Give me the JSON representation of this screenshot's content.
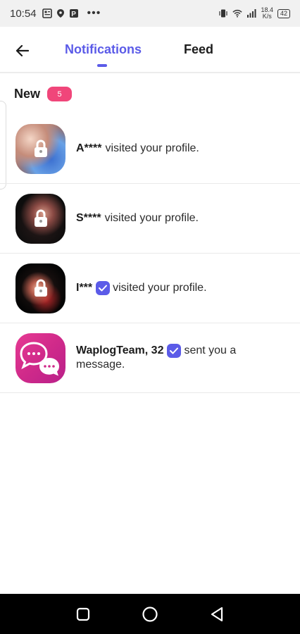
{
  "status_bar": {
    "time": "10:54",
    "dots": "•••",
    "speed_value": "18.4",
    "speed_unit": "K/s",
    "battery": "42"
  },
  "header": {
    "tabs": [
      {
        "label": "Notifications",
        "active": true
      },
      {
        "label": "Feed",
        "active": false
      }
    ],
    "accent_color": "#5b5be8"
  },
  "section": {
    "title": "New",
    "badge_count": "5",
    "badge_color": "#f0467a"
  },
  "notifications": [
    {
      "name": "A****",
      "verified": false,
      "action": "visited your profile.",
      "avatar_icon": "lock-icon"
    },
    {
      "name": "S****",
      "verified": false,
      "action": "visited your profile.",
      "avatar_icon": "lock-icon"
    },
    {
      "name": "I***",
      "verified": true,
      "action": "visited your profile.",
      "avatar_icon": "lock-icon"
    },
    {
      "name": "WaplogTeam, 32",
      "verified": true,
      "action_line1": "sent you a",
      "action_line2": "message.",
      "avatar_icon": "chat-bubbles-icon"
    }
  ],
  "nav_bar": {
    "icons": [
      "recent-apps-icon",
      "home-icon",
      "back-triangle-icon"
    ]
  }
}
